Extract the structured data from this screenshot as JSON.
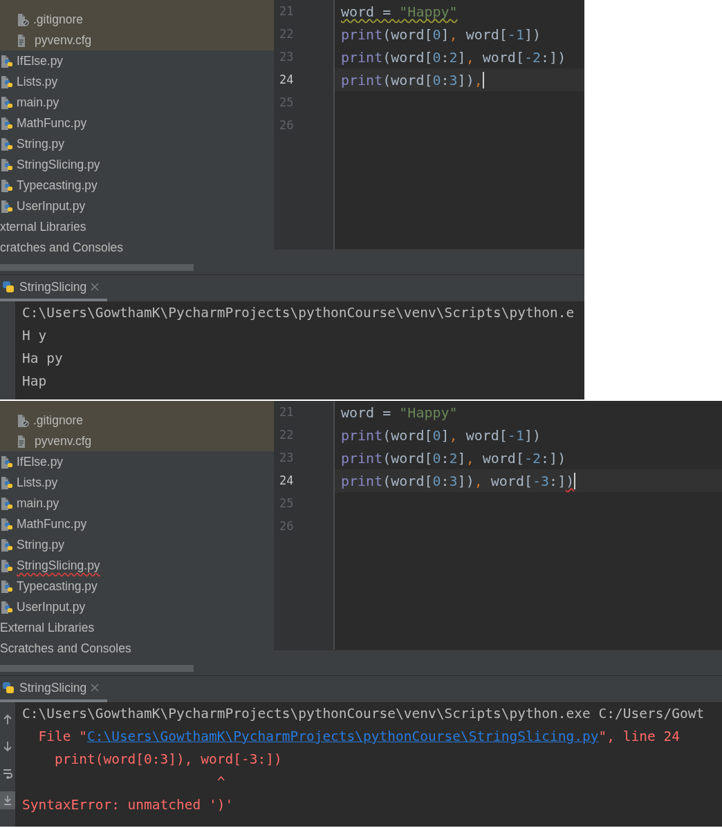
{
  "panels": [
    {
      "tree": {
        "venv_files": [
          {
            "label": ".gitignore",
            "kind": "ignore",
            "error": false
          },
          {
            "label": "pyvenv.cfg",
            "kind": "text",
            "error": false
          }
        ],
        "files": [
          {
            "label": "IfElse.py",
            "kind": "python",
            "error": false
          },
          {
            "label": "Lists.py",
            "kind": "python",
            "error": false
          },
          {
            "label": "main.py",
            "kind": "python",
            "error": false
          },
          {
            "label": "MathFunc.py",
            "kind": "python",
            "error": false
          },
          {
            "label": "String.py",
            "kind": "python",
            "error": false
          },
          {
            "label": "StringSlicing.py",
            "kind": "python",
            "error": false
          },
          {
            "label": "Typecasting.py",
            "kind": "python",
            "error": false
          },
          {
            "label": "UserInput.py",
            "kind": "python",
            "error": false
          }
        ],
        "roots": [
          {
            "label": "xternal Libraries"
          },
          {
            "label": "cratches and Consoles"
          }
        ]
      },
      "editor": {
        "lines": [
          {
            "number": "21",
            "current": false,
            "caret": false,
            "tokens": [
              {
                "text": "word = ",
                "kind": "plain",
                "warning": true
              },
              {
                "text": "\"Happy\"",
                "kind": "string",
                "warning": true
              }
            ]
          },
          {
            "number": "22",
            "current": false,
            "caret": false,
            "tokens": [
              {
                "text": "print",
                "kind": "builtin"
              },
              {
                "text": "(word[",
                "kind": "plain"
              },
              {
                "text": "0",
                "kind": "number"
              },
              {
                "text": "]",
                "kind": "plain"
              },
              {
                "text": ",",
                "kind": "comma"
              },
              {
                "text": " word[",
                "kind": "plain"
              },
              {
                "text": "-1",
                "kind": "number"
              },
              {
                "text": "])",
                "kind": "plain"
              }
            ]
          },
          {
            "number": "23",
            "current": false,
            "caret": false,
            "tokens": [
              {
                "text": "print",
                "kind": "builtin"
              },
              {
                "text": "(word[",
                "kind": "plain"
              },
              {
                "text": "0",
                "kind": "number"
              },
              {
                "text": ":",
                "kind": "plain"
              },
              {
                "text": "2",
                "kind": "number"
              },
              {
                "text": "]",
                "kind": "plain"
              },
              {
                "text": ",",
                "kind": "comma"
              },
              {
                "text": " word[",
                "kind": "plain"
              },
              {
                "text": "-2",
                "kind": "number"
              },
              {
                "text": ":])",
                "kind": "plain"
              }
            ]
          },
          {
            "number": "24",
            "current": true,
            "caret": true,
            "tokens": [
              {
                "text": "print",
                "kind": "builtin"
              },
              {
                "text": "(word[",
                "kind": "plain"
              },
              {
                "text": "0",
                "kind": "number"
              },
              {
                "text": ":",
                "kind": "plain"
              },
              {
                "text": "3",
                "kind": "number"
              },
              {
                "text": "])",
                "kind": "plain"
              },
              {
                "text": ",",
                "kind": "comma"
              }
            ]
          },
          {
            "number": "25",
            "current": false,
            "caret": false
          },
          {
            "number": "26",
            "current": false,
            "caret": false
          }
        ]
      },
      "run_tab": {
        "label": "StringSlicing",
        "selected": true
      },
      "console": [
        {
          "kind": "command",
          "text": "C:\\Users\\GowthamK\\PycharmProjects\\pythonCourse\\venv\\Scripts\\python.e"
        },
        {
          "kind": "output",
          "text": "H y"
        },
        {
          "kind": "output",
          "text": "Ha py"
        },
        {
          "kind": "output",
          "text": "Hap"
        }
      ]
    },
    {
      "tree": {
        "venv_files": [
          {
            "label": ".gitignore",
            "kind": "ignore",
            "error": false
          },
          {
            "label": "pyvenv.cfg",
            "kind": "text",
            "error": false
          }
        ],
        "files": [
          {
            "label": "IfElse.py",
            "kind": "python",
            "error": false
          },
          {
            "label": "Lists.py",
            "kind": "python",
            "error": false
          },
          {
            "label": "main.py",
            "kind": "python",
            "error": false
          },
          {
            "label": "MathFunc.py",
            "kind": "python",
            "error": false
          },
          {
            "label": "String.py",
            "kind": "python",
            "error": false
          },
          {
            "label": "StringSlicing.py",
            "kind": "python",
            "error": true
          },
          {
            "label": "Typecasting.py",
            "kind": "python",
            "error": false
          },
          {
            "label": "UserInput.py",
            "kind": "python",
            "error": false
          }
        ],
        "roots": [
          {
            "label": "External Libraries"
          },
          {
            "label": "Scratches and Consoles"
          }
        ]
      },
      "editor": {
        "lines": [
          {
            "number": "21",
            "current": false,
            "caret": false,
            "tokens": [
              {
                "text": "word = ",
                "kind": "plain"
              },
              {
                "text": "\"Happy\"",
                "kind": "string"
              }
            ]
          },
          {
            "number": "22",
            "current": false,
            "caret": false,
            "tokens": [
              {
                "text": "print",
                "kind": "builtin"
              },
              {
                "text": "(word[",
                "kind": "plain"
              },
              {
                "text": "0",
                "kind": "number"
              },
              {
                "text": "]",
                "kind": "plain"
              },
              {
                "text": ",",
                "kind": "comma"
              },
              {
                "text": " word[",
                "kind": "plain"
              },
              {
                "text": "-1",
                "kind": "number"
              },
              {
                "text": "])",
                "kind": "plain"
              }
            ]
          },
          {
            "number": "23",
            "current": false,
            "caret": false,
            "tokens": [
              {
                "text": "print",
                "kind": "builtin"
              },
              {
                "text": "(word[",
                "kind": "plain"
              },
              {
                "text": "0",
                "kind": "number"
              },
              {
                "text": ":",
                "kind": "plain"
              },
              {
                "text": "2",
                "kind": "number"
              },
              {
                "text": "]",
                "kind": "plain"
              },
              {
                "text": ",",
                "kind": "comma"
              },
              {
                "text": " word[",
                "kind": "plain"
              },
              {
                "text": "-2",
                "kind": "number"
              },
              {
                "text": ":])",
                "kind": "plain"
              }
            ]
          },
          {
            "number": "24",
            "current": true,
            "caret": true,
            "tokens": [
              {
                "text": "print",
                "kind": "builtin"
              },
              {
                "text": "(word[",
                "kind": "plain"
              },
              {
                "text": "0",
                "kind": "number"
              },
              {
                "text": ":",
                "kind": "plain"
              },
              {
                "text": "3",
                "kind": "number"
              },
              {
                "text": "])",
                "kind": "plain"
              },
              {
                "text": ",",
                "kind": "comma"
              },
              {
                "text": " word[",
                "kind": "plain"
              },
              {
                "text": "-3",
                "kind": "number"
              },
              {
                "text": ":]",
                "kind": "plain"
              },
              {
                "text": ")",
                "kind": "plain",
                "error": true
              }
            ]
          },
          {
            "number": "25",
            "current": false,
            "caret": false
          },
          {
            "number": "26",
            "current": false,
            "caret": false
          }
        ]
      },
      "run_tab": {
        "label": "StringSlicing",
        "selected": true
      },
      "console_tools": [
        {
          "kind": "up"
        },
        {
          "kind": "down"
        },
        {
          "kind": "wrap"
        },
        {
          "kind": "scroll-end",
          "on": true
        }
      ],
      "console": [
        {
          "kind": "command",
          "text": "C:\\Users\\GowthamK\\PycharmProjects\\pythonCourse\\venv\\Scripts\\python.exe C:/Users/Gowt"
        },
        {
          "kind": "error",
          "text": "  File \"",
          "link": "C:\\Users\\GowthamK\\PycharmProjects\\pythonCourse\\StringSlicing.py",
          "after": "\", line 24"
        },
        {
          "kind": "error",
          "text": "    print(word[0:3]), word[-3:])"
        },
        {
          "kind": "error",
          "text": "                        ^"
        },
        {
          "kind": "error",
          "text": "SyntaxError: unmatched ')'"
        }
      ]
    }
  ]
}
